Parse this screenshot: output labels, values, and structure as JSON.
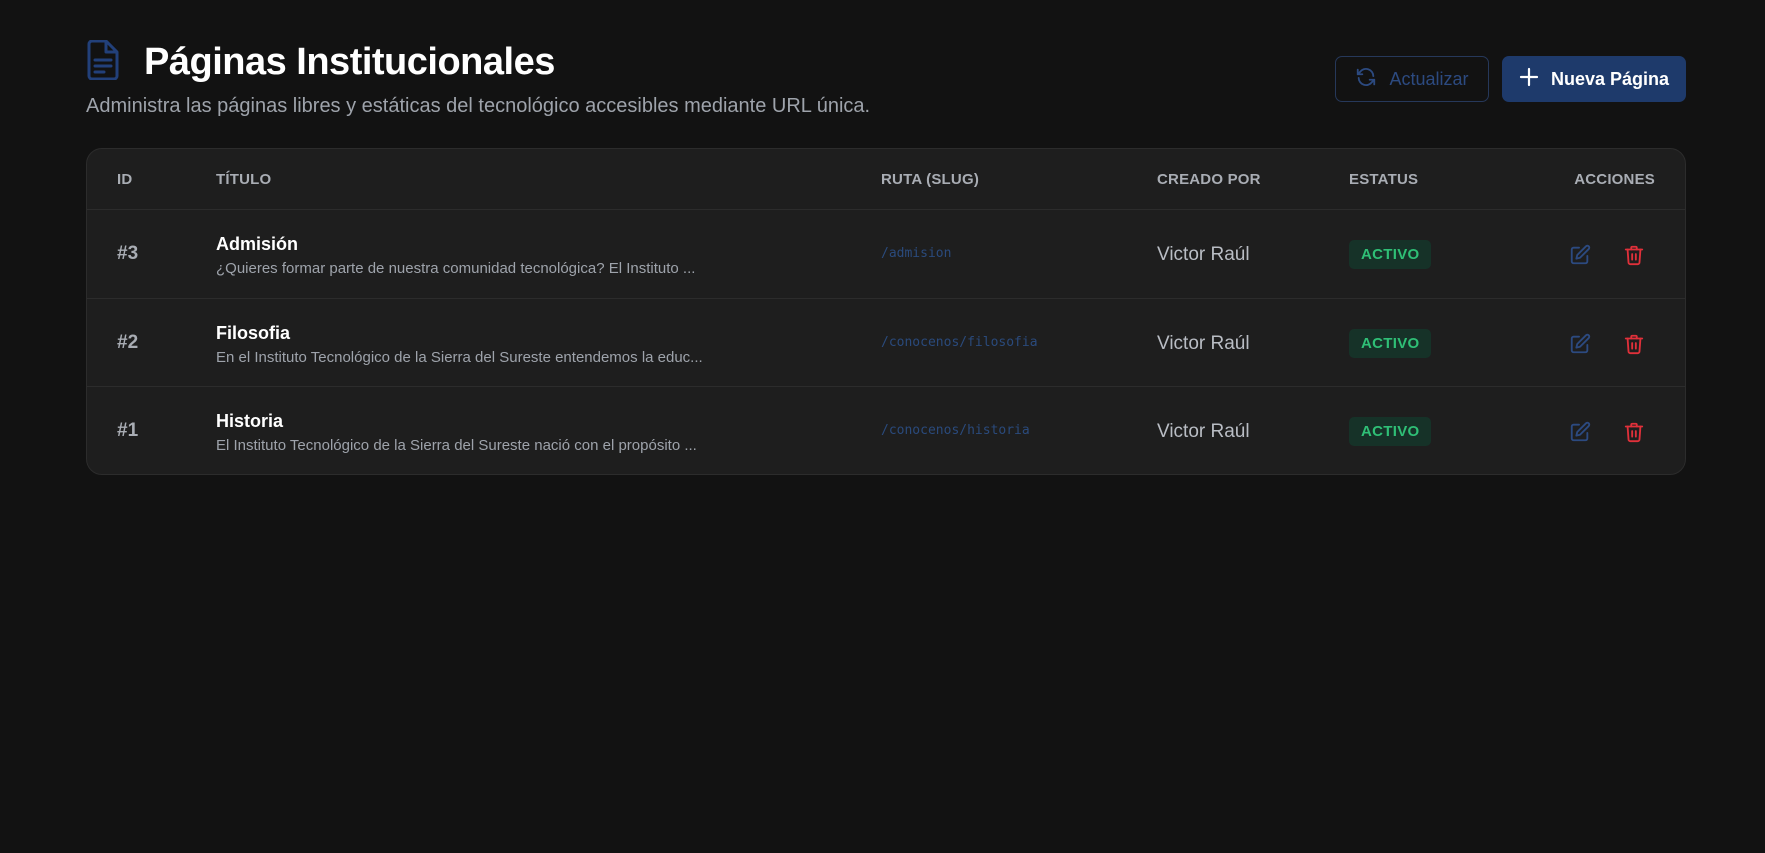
{
  "header": {
    "title": "Páginas Institucionales",
    "subtitle": "Administra las páginas libres y estáticas del tecnológico accesibles mediante URL única.",
    "icon": "document-icon"
  },
  "toolbar": {
    "refresh_label": "Actualizar",
    "refresh_icon": "refresh-icon",
    "new_label": "Nueva Página",
    "new_icon": "plus-icon"
  },
  "table": {
    "columns": {
      "id": "ID",
      "title": "TÍTULO",
      "slug": "RUTA (SLUG)",
      "author": "CREADO POR",
      "status": "ESTATUS",
      "actions": "ACCIONES"
    },
    "rows": [
      {
        "id": "#3",
        "title": "Admisión",
        "excerpt": "¿Quieres formar parte de nuestra comunidad tecnológica? El Instituto ...",
        "slug": "/admision",
        "author": "Victor Raúl",
        "status": "ACTIVO"
      },
      {
        "id": "#2",
        "title": "Filosofia",
        "excerpt": "En el Instituto Tecnológico de la Sierra del Sureste entendemos la educ...",
        "slug": "/conocenos/filosofia",
        "author": "Victor Raúl",
        "status": "ACTIVO"
      },
      {
        "id": "#1",
        "title": "Historia",
        "excerpt": "El Instituto Tecnológico de la Sierra del Sureste nació con el propósito ...",
        "slug": "/conocenos/historia",
        "author": "Victor Raúl",
        "status": "ACTIVO"
      }
    ]
  },
  "colors": {
    "background": "#121212",
    "card": "#1e1e1e",
    "accent": "#1e3a6b",
    "status_active": "#2fbf76",
    "delete": "#e0303a",
    "edit": "#2c4a80"
  }
}
